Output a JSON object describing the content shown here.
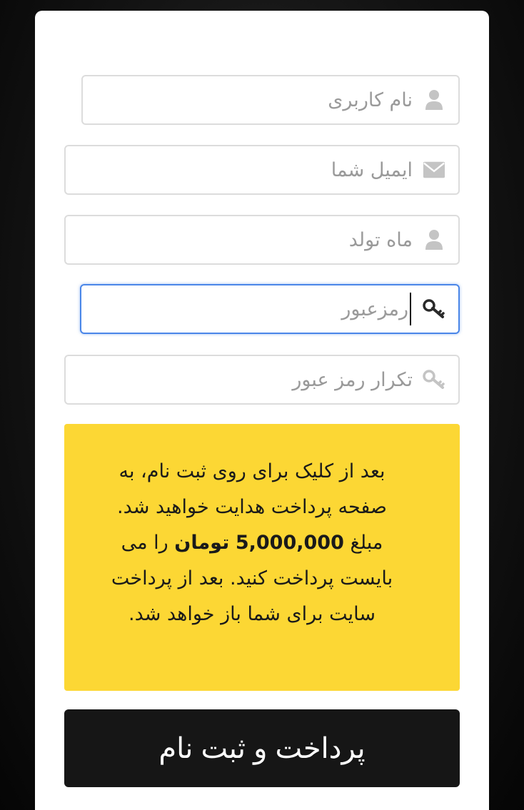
{
  "form": {
    "username_placeholder": "نام کاربری",
    "email_placeholder": "ایمیل شما",
    "birth_month_placeholder": "ماه تولد",
    "password_placeholder": "رمزعبور",
    "password_repeat_placeholder": "تکرار رمز عبور"
  },
  "notice": {
    "text_before_amount": "بعد از کلیک برای روی ثبت نام، به صفحه پرداخت هدایت خواهید شد. مبلغ",
    "amount": "5,000,000",
    "currency": "تومان",
    "text_after_amount": "را می بایست پرداخت کنید. بعد از پرداخت سایت برای شما باز خواهد شد."
  },
  "submit_label": "پرداخت و ثبت نام",
  "icons": {
    "username": "user-icon",
    "email": "envelope-icon",
    "birth_month": "user-icon",
    "password": "key-icon",
    "password_repeat": "key-icon"
  },
  "colors": {
    "notice_background": "#fcd734",
    "button_background": "#161616",
    "focus_border": "#4a86e8"
  }
}
